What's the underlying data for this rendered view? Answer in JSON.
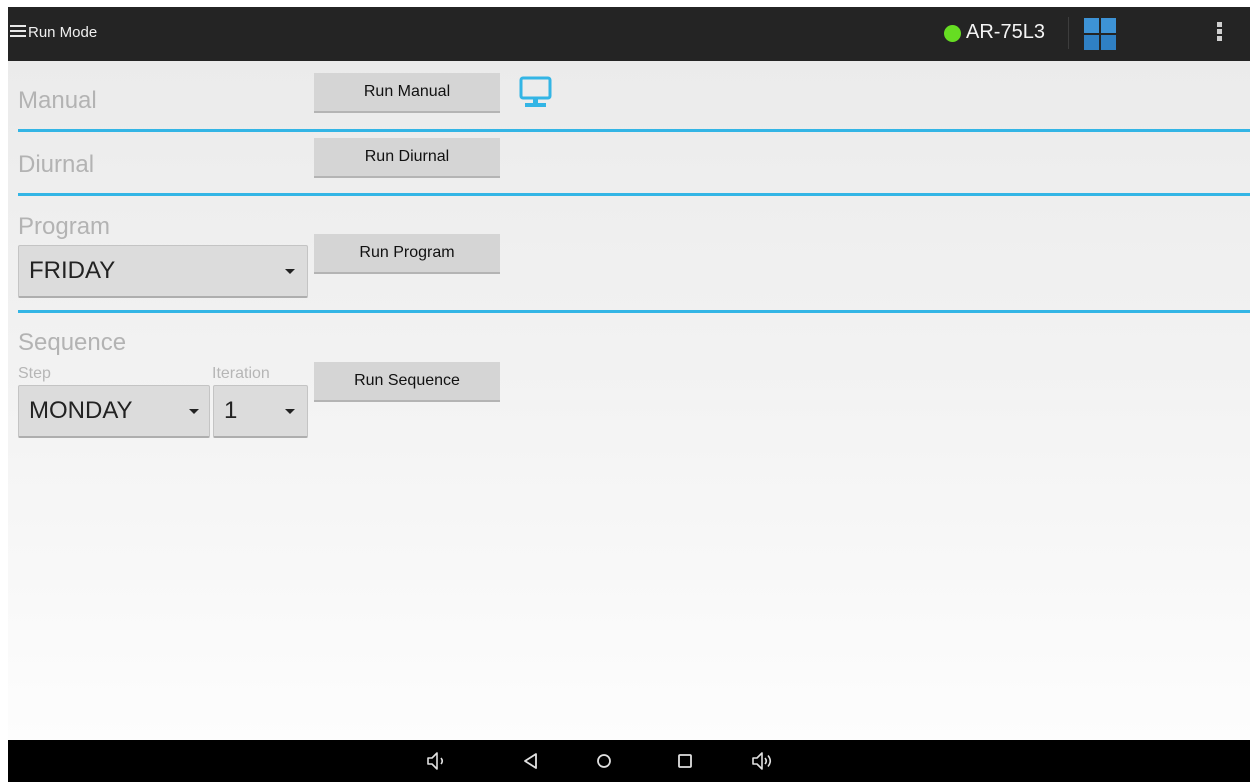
{
  "topbar": {
    "title": "Run Mode",
    "menu_icon": "hamburger-menu-icon",
    "device_status_color": "#66dd22",
    "device_name": "AR-75L3",
    "grid_icon": "grid-icon",
    "overflow_icon": "overflow-menu-icon"
  },
  "manual": {
    "label": "Manual",
    "button_label": "Run Manual",
    "extra_icon": "monitor-icon"
  },
  "diurnal": {
    "label": "Diurnal",
    "button_label": "Run Diurnal"
  },
  "program": {
    "label": "Program",
    "selected": "FRIDAY",
    "button_label": "Run Program"
  },
  "sequence": {
    "label": "Sequence",
    "step_label": "Step",
    "step_selected": "MONDAY",
    "iteration_label": "Iteration",
    "iteration_selected": "1",
    "button_label": "Run Sequence"
  },
  "navbar": {
    "icons": [
      "volume-down-icon",
      "back-icon",
      "home-icon",
      "recents-icon",
      "volume-up-icon"
    ]
  },
  "colors": {
    "accent": "#33b5e5",
    "topbar_bg": "#242424",
    "grid_icon": "#3a8fd0"
  }
}
